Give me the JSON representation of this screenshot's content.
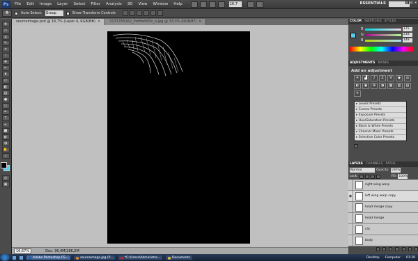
{
  "app": {
    "logo": "Ps",
    "menus": [
      "File",
      "Edit",
      "Image",
      "Layer",
      "Select",
      "Filter",
      "Analysis",
      "3D",
      "View",
      "Window",
      "Help"
    ],
    "zoom_field": "16.7",
    "workspace": "ESSENTIALS"
  },
  "options": {
    "auto_select_label": "Auto-Select:",
    "auto_select_value": "Group",
    "show_transform_label": "Show Transform Controls"
  },
  "tabs": [
    {
      "label": "sourceimage.psd @ 16,7% (Layer 4, RGB/8#)"
    },
    {
      "label": "3137783162_Profile900x_a.jpg @ 33,3% (RGB/8*)"
    }
  ],
  "status": {
    "zoom": "16,67%",
    "doc": "Doc: 36,4M/286,2M"
  },
  "color_panel": {
    "tabs": [
      "COLOR",
      "SWATCHES",
      "STYLES"
    ],
    "channels": [
      {
        "label": "R",
        "value": "175"
      },
      {
        "label": "G",
        "value": "218"
      },
      {
        "label": "B",
        "value": "148"
      }
    ],
    "fg_color": "#5ac8e8"
  },
  "adjustments": {
    "tabs": [
      "ADJUSTMENTS",
      "MASKS"
    ],
    "title": "Add an adjustment",
    "presets": [
      "Levels Presets",
      "Curves Presets",
      "Exposure Presets",
      "Hue/Saturation Presets",
      "Black & White Presets",
      "Channel Mixer Presets",
      "Selective Color Presets"
    ]
  },
  "layers": {
    "tabs": [
      "LAYERS",
      "CHANNELS",
      "PATHS"
    ],
    "blend_mode": "Normal",
    "opacity_label": "Opacity:",
    "opacity": "100%",
    "lock_label": "Lock:",
    "fill_label": "Fill:",
    "fill": "100%",
    "items": [
      {
        "name": "right wing warp",
        "visible": false
      },
      {
        "name": "left wing warp copy",
        "visible": true
      },
      {
        "name": "head merge copy",
        "visible": false
      },
      {
        "name": "head merge",
        "visible": false
      },
      {
        "name": "clic",
        "visible": false
      },
      {
        "name": "body",
        "visible": false
      }
    ]
  },
  "taskbar": {
    "tasks": [
      {
        "label": "Adobe Photoshop CS...",
        "active": true
      },
      {
        "label": "sourceimage.jpg (P...",
        "active": false
      },
      {
        "label": "*C:\\Users\\Administra...",
        "active": false
      },
      {
        "label": "Documents",
        "active": false
      }
    ],
    "desktop": "Desktop",
    "computer": "Computer",
    "clock": "01:30"
  }
}
